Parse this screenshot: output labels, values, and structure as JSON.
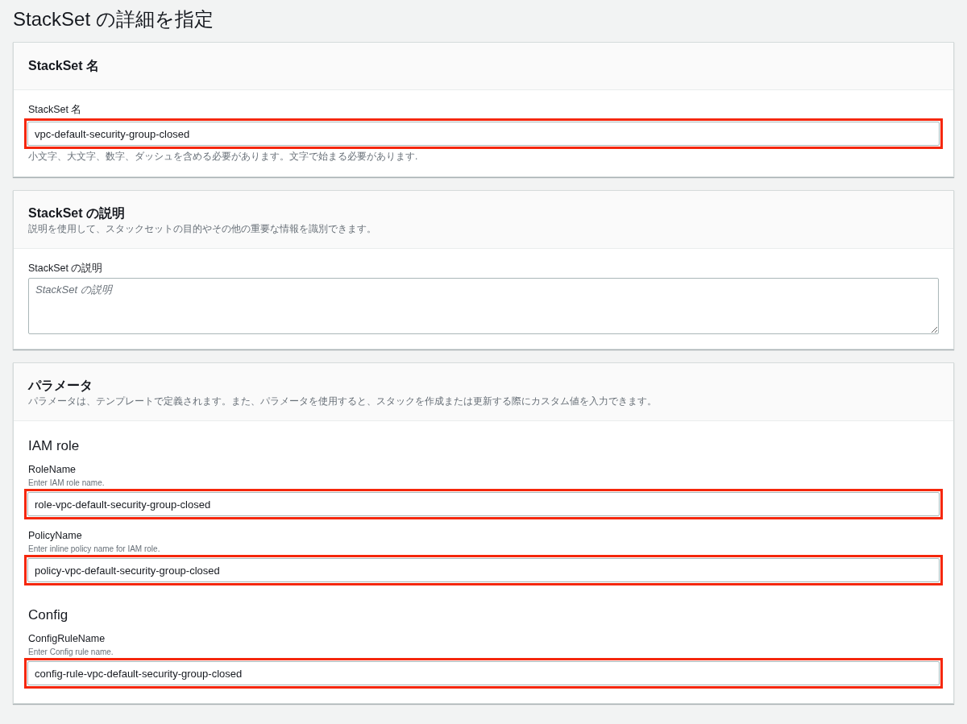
{
  "page_title": "StackSet の詳細を指定",
  "sections": [
    {
      "title": "StackSet 名",
      "groups": [
        {
          "fields": [
            {
              "label": "StackSet 名",
              "kind": "input",
              "value": "vpc-default-security-group-closed",
              "constraint": "小文字、大文字、数字、ダッシュを含める必要があります。文字で始まる必要があります.",
              "highlighted": true
            }
          ]
        }
      ]
    },
    {
      "title": "StackSet の説明",
      "description": "説明を使用して、スタックセットの目的やその他の重要な情報を識別できます。",
      "groups": [
        {
          "fields": [
            {
              "label": "StackSet の説明",
              "kind": "textarea",
              "placeholder": "StackSet の説明",
              "highlighted": false
            }
          ]
        }
      ]
    },
    {
      "title": "パラメータ",
      "description": "パラメータは、テンプレートで定義されます。また、パラメータを使用すると、スタックを作成または更新する際にカスタム値を入力できます。",
      "groups": [
        {
          "heading": "IAM role",
          "fields": [
            {
              "label": "RoleName",
              "hint": "Enter IAM role name.",
              "kind": "input",
              "value": "role-vpc-default-security-group-closed",
              "highlighted": true
            },
            {
              "label": "PolicyName",
              "hint": "Enter inline policy name for IAM role.",
              "kind": "input",
              "value": "policy-vpc-default-security-group-closed",
              "highlighted": true
            }
          ]
        },
        {
          "heading": "Config",
          "fields": [
            {
              "label": "ConfigRuleName",
              "hint": "Enter Config rule name.",
              "kind": "input",
              "value": "config-rule-vpc-default-security-group-closed",
              "highlighted": true
            }
          ]
        }
      ]
    }
  ]
}
